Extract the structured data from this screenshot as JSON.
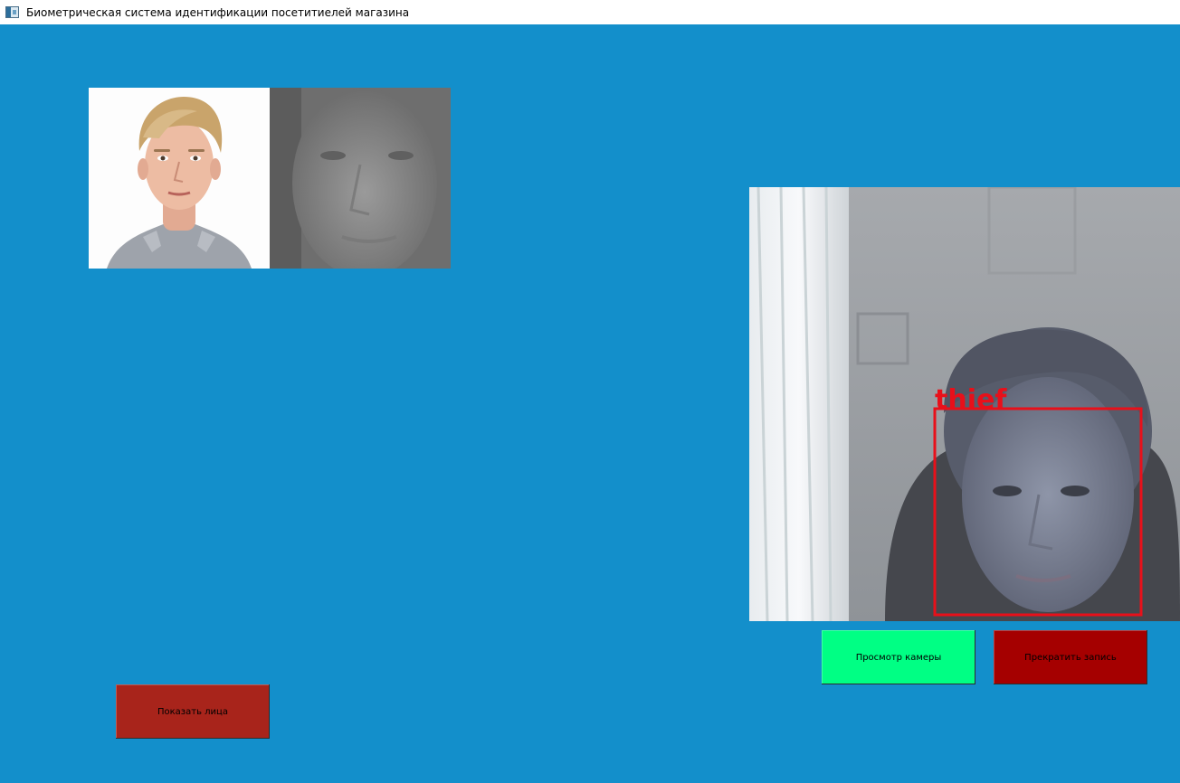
{
  "window": {
    "title": "Биометрическая система идентификации посетитиелей магазина",
    "icon": "app-window-icon"
  },
  "faces": {
    "reference_photo": "reference-face-photo",
    "grayscale_photo": "grayscale-face-photo"
  },
  "camera": {
    "detection_label": "thief",
    "box_color": "#e8101a"
  },
  "buttons": {
    "view_camera": "Просмотр камеры",
    "stop_recording": "Прекратить запись",
    "show_faces": "Показать лица"
  },
  "colors": {
    "background": "#138fcb",
    "view_camera_button": "#00ff84",
    "stop_button": "#a50000",
    "show_faces_button": "#a8241b"
  }
}
